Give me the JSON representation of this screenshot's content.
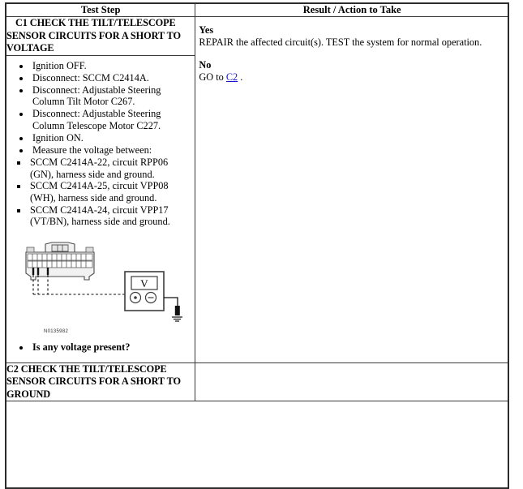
{
  "table": {
    "headers": {
      "col1": "Test Step",
      "col2": "Result / Action to Take"
    }
  },
  "section_c1": {
    "title_line1": "C1 CHECK THE TILT/TELESCOPE",
    "title_line2": "SENSOR CIRCUITS FOR A SHORT TO",
    "title_line3": "VOLTAGE",
    "steps": [
      "Ignition OFF.",
      "Disconnect: SCCM C2414A.",
      "Disconnect: Adjustable Steering Column Tilt Motor C267.",
      "Disconnect: Adjustable Steering Column Telescope Motor C227.",
      "Ignition ON.",
      "Measure the voltage between:"
    ],
    "substeps": [
      "SCCM C2414A-22, circuit RPP06 (GN), harness side and ground.",
      "SCCM C2414A-25, circuit VPP08 (WH), harness side and ground.",
      "SCCM C2414A-24, circuit VPP17 (VT/BN), harness side and ground."
    ],
    "figure": {
      "code": "N0135982",
      "meter_label": "V",
      "terminal_positive": "⊙",
      "terminal_negative": "⊖"
    },
    "question": "Is any voltage present?",
    "result": {
      "yes_label": "Yes",
      "yes_text": "REPAIR the affected circuit(s). TEST the system for normal operation.",
      "no_label": "No",
      "no_text_before": "GO to ",
      "no_link": "C2",
      "no_text_after": " ."
    }
  },
  "section_c2": {
    "title_line1": "C2 CHECK THE TILT/TELESCOPE",
    "title_line2": "SENSOR CIRCUITS FOR A SHORT TO",
    "title_line3": "GROUND"
  },
  "colors": {
    "link": "#1414cc",
    "border": "#2b2b2b",
    "text": "#000000"
  }
}
